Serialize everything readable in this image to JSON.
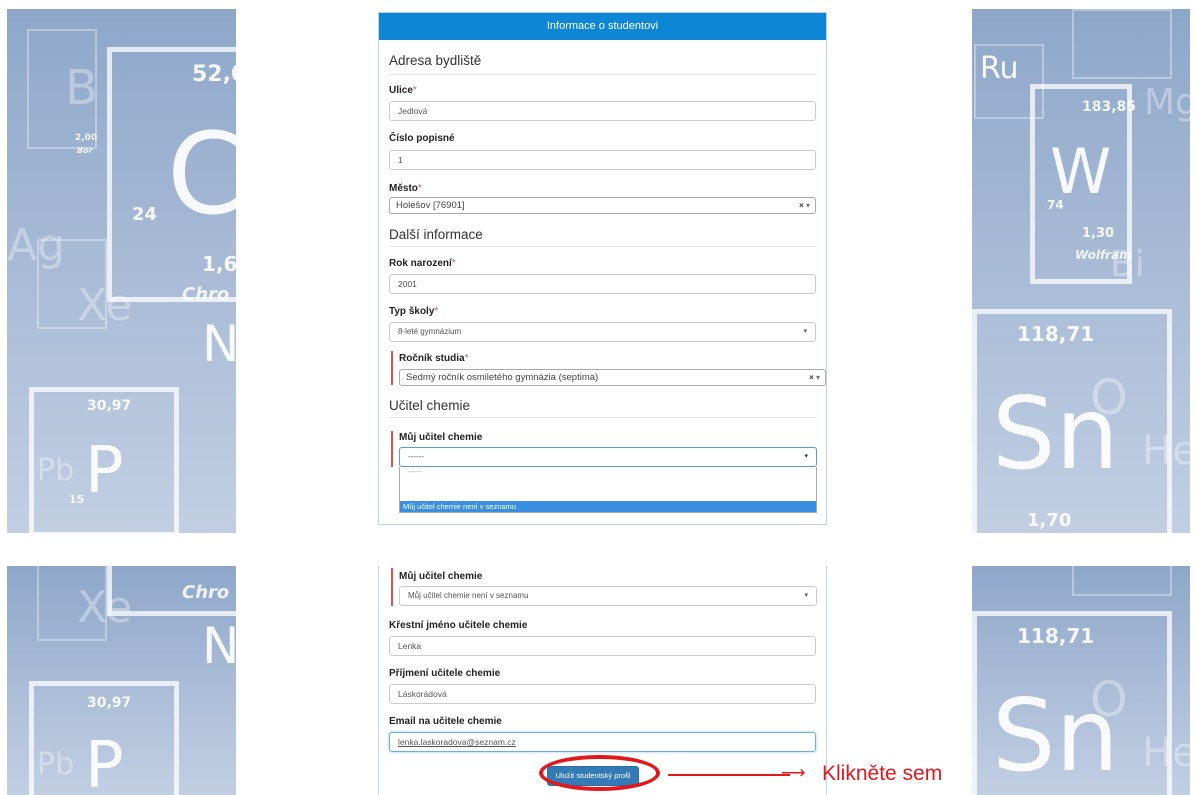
{
  "panel_title": "Informace o studentovi",
  "colors": {
    "header_blue": "#0d86d6",
    "required_red": "#d9534f",
    "button_blue": "#337ab7",
    "annotation_red": "#e0191d",
    "highlight_blue": "#3b8fe0"
  },
  "address": {
    "section_title": "Adresa bydliště",
    "street_label": "Ulice",
    "street_value": "Jedlová",
    "house_number_label": "Číslo popisné",
    "house_number_value": "1",
    "city_label": "Město",
    "city_value": "Holešov [76901]"
  },
  "more_info": {
    "section_title": "Další informace",
    "birth_year_label": "Rok narození",
    "birth_year_value": "2001",
    "school_type_label": "Typ školy",
    "school_type_value": "8-leté gymnázium",
    "study_year_label": "Ročník studia",
    "study_year_value": "Sedmý ročník osmiletého gymnázia (septima)"
  },
  "teacher": {
    "section_title": "Učitel chemie",
    "my_teacher_label": "Můj učitel chemie",
    "my_teacher_placeholder": "------",
    "dropdown_option_empty": "------",
    "dropdown_option_not_listed": "Můj učitel chemie není v seznamu"
  },
  "teacher_details": {
    "my_teacher_label": "Můj učitel chemie",
    "my_teacher_value": "Můj učitel chemie není v seznamu",
    "first_name_label": "Křestní jméno učitele chemie",
    "first_name_value": "Lenka",
    "last_name_label": "Příjmení učitele chemie",
    "last_name_value": "Láskorádová",
    "email_label": "Email na učitele chemie",
    "email_value": "lenka.laskoradova@seznam.cz",
    "save_button": "Uložit studentský profil"
  },
  "required_marker": "*",
  "clear_glyph": "×",
  "caret_glyph": "▾",
  "annotation": {
    "text": "Klikněte sem",
    "arrow": "⟶"
  },
  "background": {
    "left_top": {
      "symbols": [
        "B",
        "C",
        "Ag",
        "Xe",
        "N",
        "P",
        "Pb"
      ],
      "numbers": [
        "52,0",
        "24",
        "1,6",
        "30,97",
        "15",
        "2,00"
      ],
      "names": [
        "Chro",
        "Bor"
      ]
    },
    "right_top": {
      "symbols": [
        "Ru",
        "W",
        "Sn",
        "O",
        "Bi",
        "He",
        "Mg"
      ],
      "numbers": [
        "183,85",
        "74",
        "1,30",
        "118,71",
        "1,70"
      ],
      "names": [
        "Wolfram"
      ]
    },
    "left_bottom": {
      "symbols": [
        "Xe",
        "N",
        "P",
        "Pb"
      ],
      "numbers": [
        "30,97"
      ],
      "names": [
        "Chro"
      ]
    },
    "right_bottom": {
      "symbols": [
        "Sn",
        "O",
        "He"
      ],
      "numbers": [
        "118,71"
      ],
      "names": []
    }
  }
}
